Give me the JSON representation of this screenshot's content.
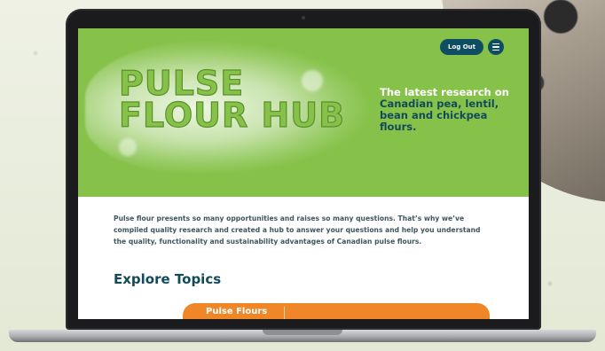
{
  "hero": {
    "title_line1": "PULSE",
    "title_line2": "FLOUR HUB",
    "tagline_lead": "The latest research on",
    "tagline_rest": "Canadian pea, lentil, bean and chickpea flours.",
    "background_color": "#86c24a"
  },
  "header": {
    "logout_label": "Log Out",
    "menu_icon": "hamburger-menu-icon"
  },
  "main": {
    "intro_text": "Pulse flour presents so many opportunities and raises so many questions. That’s why we’ve compiled quality research and created a hub to answer your questions and help you understand the quality, functionality and sustainability advantages of Canadian pulse flours.",
    "explore_heading": "Explore Topics",
    "topics": [
      {
        "label": "Pulse Flours",
        "color": "#ef8628"
      }
    ]
  },
  "colors": {
    "brand_dark": "#0e4d64",
    "brand_green": "#86c24a",
    "accent_orange": "#ef8628"
  }
}
